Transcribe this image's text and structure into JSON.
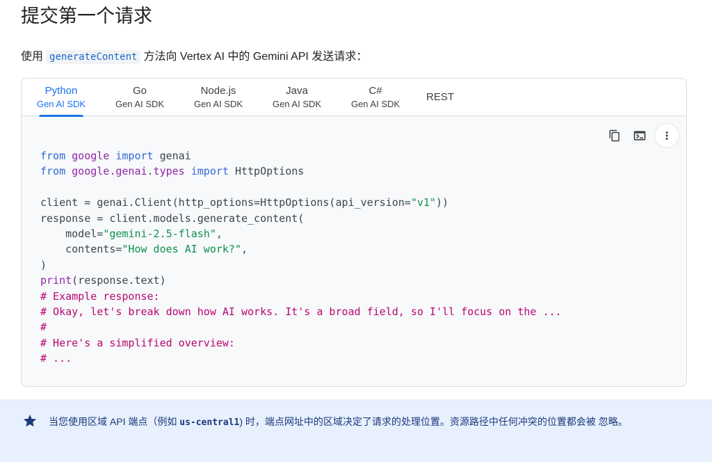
{
  "page": {
    "title": "提交第一个请求",
    "intro_before": "使用",
    "intro_code": "generateContent",
    "intro_after": "方法向 Vertex AI 中的 Gemini API 发送请求："
  },
  "tabs": [
    {
      "label": "Python",
      "sub": "Gen AI SDK",
      "active": true
    },
    {
      "label": "Go",
      "sub": "Gen AI SDK"
    },
    {
      "label": "Node.js",
      "sub": "Gen AI SDK"
    },
    {
      "label": "Java",
      "sub": "Gen AI SDK"
    },
    {
      "label": "C#",
      "sub": "Gen AI SDK"
    },
    {
      "label": "REST",
      "sub": ""
    }
  ],
  "code": {
    "l1": {
      "k1": "from",
      "m1": "google",
      "k2": "import",
      "r": "genai"
    },
    "l2": {
      "k1": "from",
      "m1": "google.genai.types",
      "k2": "import",
      "r": "HttpOptions"
    },
    "l4": {
      "a": "client = genai.Client(http_options=HttpOptions(api_version=",
      "s": "\"v1\"",
      "b": "))"
    },
    "l5": "response = client.models.generate_content(",
    "l6": {
      "a": "    model=",
      "s": "\"gemini-2.5-flash\"",
      "b": ","
    },
    "l7": {
      "a": "    contents=",
      "s": "\"How does AI work?\"",
      "b": ","
    },
    "l8": ")",
    "l9": {
      "k": "print",
      "r": "(response.text)"
    },
    "c1": "# Example response:",
    "c2": "# Okay, let's break down how AI works. It's a broad field, so I'll focus on the ...",
    "c3": "#",
    "c4": "# Here's a simplified overview:",
    "c5": "# ..."
  },
  "icons": {
    "copy": "copy-icon",
    "terminal": "terminal-icon",
    "more": "more-vert-icon",
    "star": "star-icon"
  },
  "callout": {
    "before": "当您使用区域 API 端点（例如",
    "code": "us-central1",
    "after": ") 时，端点网址中的区域决定了请求的处理位置。资源路径中任何冲突的位置都会被 忽略。"
  },
  "colors": {
    "accent": "#1a73e8",
    "keyword": "#3367d6",
    "module": "#8e24aa",
    "string": "#0d904f",
    "comment": "#b80672",
    "callout_bg": "#e8f0fe"
  }
}
